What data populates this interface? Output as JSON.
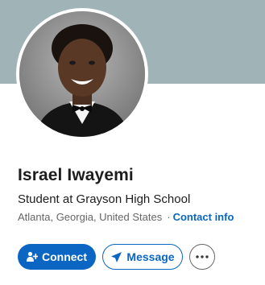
{
  "profile": {
    "name": "Israel Iwayemi",
    "headline": "Student at Grayson High School",
    "location": "Atlanta, Georgia, United States",
    "separator": "·",
    "contact_link": "Contact info"
  },
  "actions": {
    "connect_label": "Connect",
    "message_label": "Message",
    "more_icon": "ellipsis-icon"
  },
  "colors": {
    "cover": "#a0b4b7",
    "accent": "#0a66c2",
    "text": "#1d1d1d",
    "muted": "#666666"
  }
}
